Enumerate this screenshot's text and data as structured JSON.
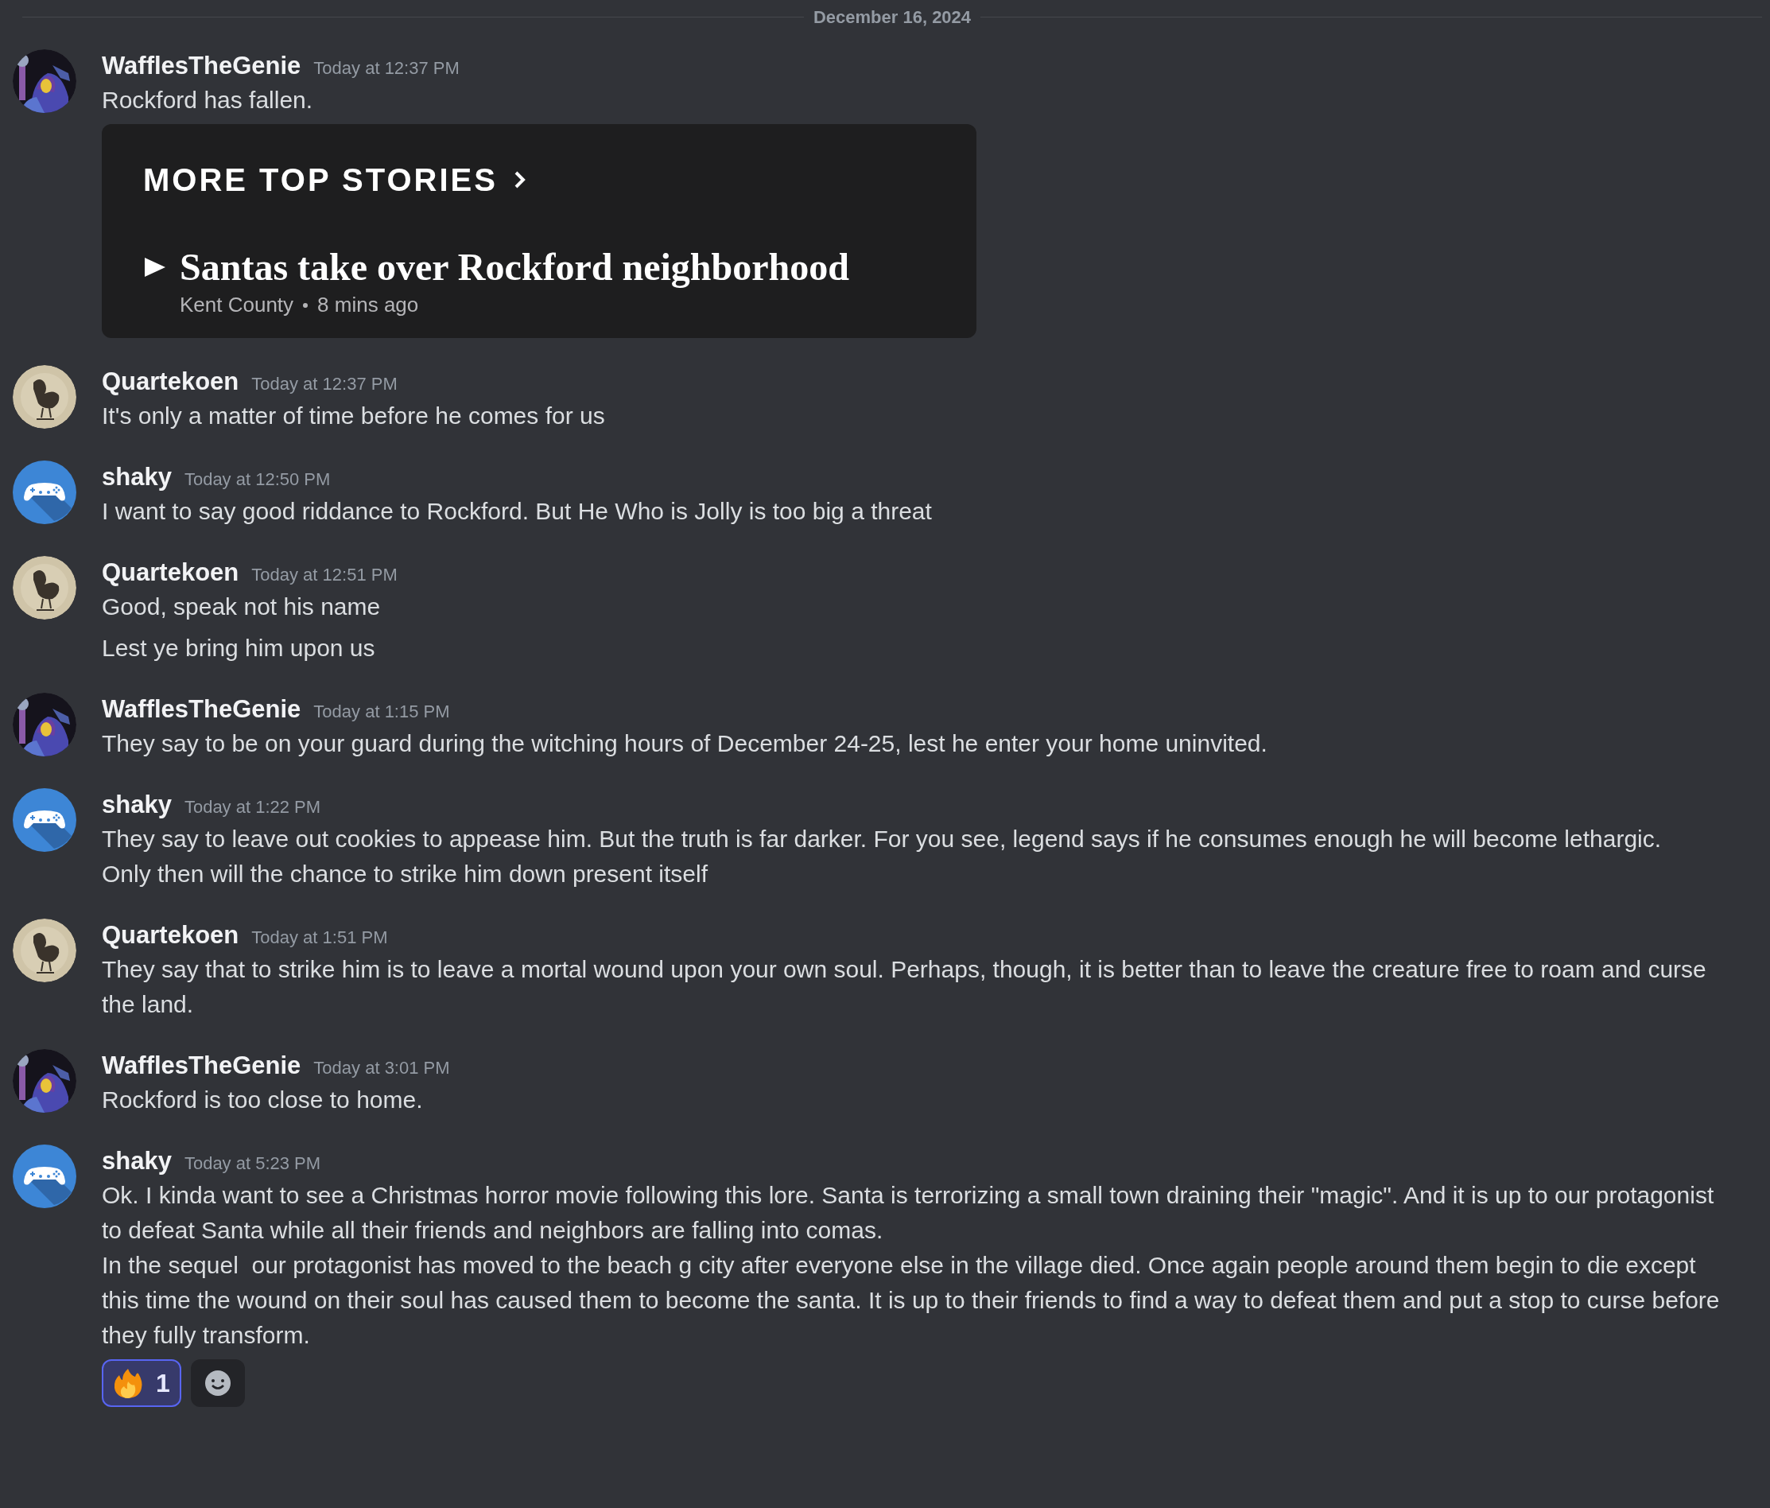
{
  "date_divider": "December 16, 2024",
  "groups": [
    {
      "author": "WafflesTheGenie",
      "avatar": {
        "kind": "figure"
      },
      "timestamp": "Today at 12:37 PM",
      "messages": [
        {
          "paragraphs": [
            "Rockford has fallen."
          ]
        }
      ],
      "embed": {
        "kicker": "MORE TOP STORIES",
        "headline": "Santas take over Rockford neighborhood",
        "source": "Kent County",
        "age": "8 mins ago"
      }
    },
    {
      "author": "Quartekoen",
      "avatar": {
        "kind": "bird"
      },
      "timestamp": "Today at 12:37 PM",
      "messages": [
        {
          "paragraphs": [
            "It's only a matter of time before he comes for us"
          ]
        }
      ]
    },
    {
      "author": "shaky",
      "avatar": {
        "kind": "controller"
      },
      "timestamp": "Today at 12:50 PM",
      "messages": [
        {
          "paragraphs": [
            "I want to say good riddance to Rockford. But He Who is Jolly is too big a threat"
          ]
        }
      ]
    },
    {
      "author": "Quartekoen",
      "avatar": {
        "kind": "bird"
      },
      "timestamp": "Today at 12:51 PM",
      "messages": [
        {
          "paragraphs": [
            "Good, speak not his name"
          ]
        },
        {
          "paragraphs": [
            "Lest ye bring him upon us"
          ]
        }
      ]
    },
    {
      "author": "WafflesTheGenie",
      "avatar": {
        "kind": "figure"
      },
      "timestamp": "Today at 1:15 PM",
      "messages": [
        {
          "paragraphs": [
            "They say to be on your guard during the witching hours of December 24-25, lest he enter your home uninvited."
          ]
        }
      ]
    },
    {
      "author": "shaky",
      "avatar": {
        "kind": "controller"
      },
      "timestamp": "Today at 1:22 PM",
      "messages": [
        {
          "paragraphs": [
            "They say to leave out cookies to appease him. But the truth is far darker. For you see, legend says if he consumes enough he will become lethargic.",
            "Only then will the chance to strike him down present itself"
          ]
        }
      ]
    },
    {
      "author": "Quartekoen",
      "avatar": {
        "kind": "bird"
      },
      "timestamp": "Today at 1:51 PM",
      "messages": [
        {
          "paragraphs": [
            "They say that to strike him is to leave a mortal wound upon your own soul. Perhaps, though, it is better than to leave the creature free to roam and curse the land."
          ]
        }
      ]
    },
    {
      "author": "WafflesTheGenie",
      "avatar": {
        "kind": "figure"
      },
      "timestamp": "Today at 3:01 PM",
      "messages": [
        {
          "paragraphs": [
            "Rockford is too close to home."
          ]
        }
      ]
    },
    {
      "author": "shaky",
      "avatar": {
        "kind": "controller"
      },
      "timestamp": "Today at 5:23 PM",
      "messages": [
        {
          "paragraphs": [
            "Ok. I kinda want to see a Christmas horror movie following this lore. Santa is terrorizing a small town draining their \"magic\". And it is up to our protagonist to defeat Santa while all their friends and neighbors are falling into comas.",
            "In the sequel  our protagonist has moved to the beach g city after everyone else in the village died. Once again people around them begin to die except this time the wound on their soul has caused them to become the santa. It is up to their friends to find a way to defeat them and put a stop to curse before they fully transform."
          ]
        }
      ],
      "reactions": [
        {
          "kind": "fire",
          "count": "1",
          "selected": true
        }
      ]
    }
  ]
}
